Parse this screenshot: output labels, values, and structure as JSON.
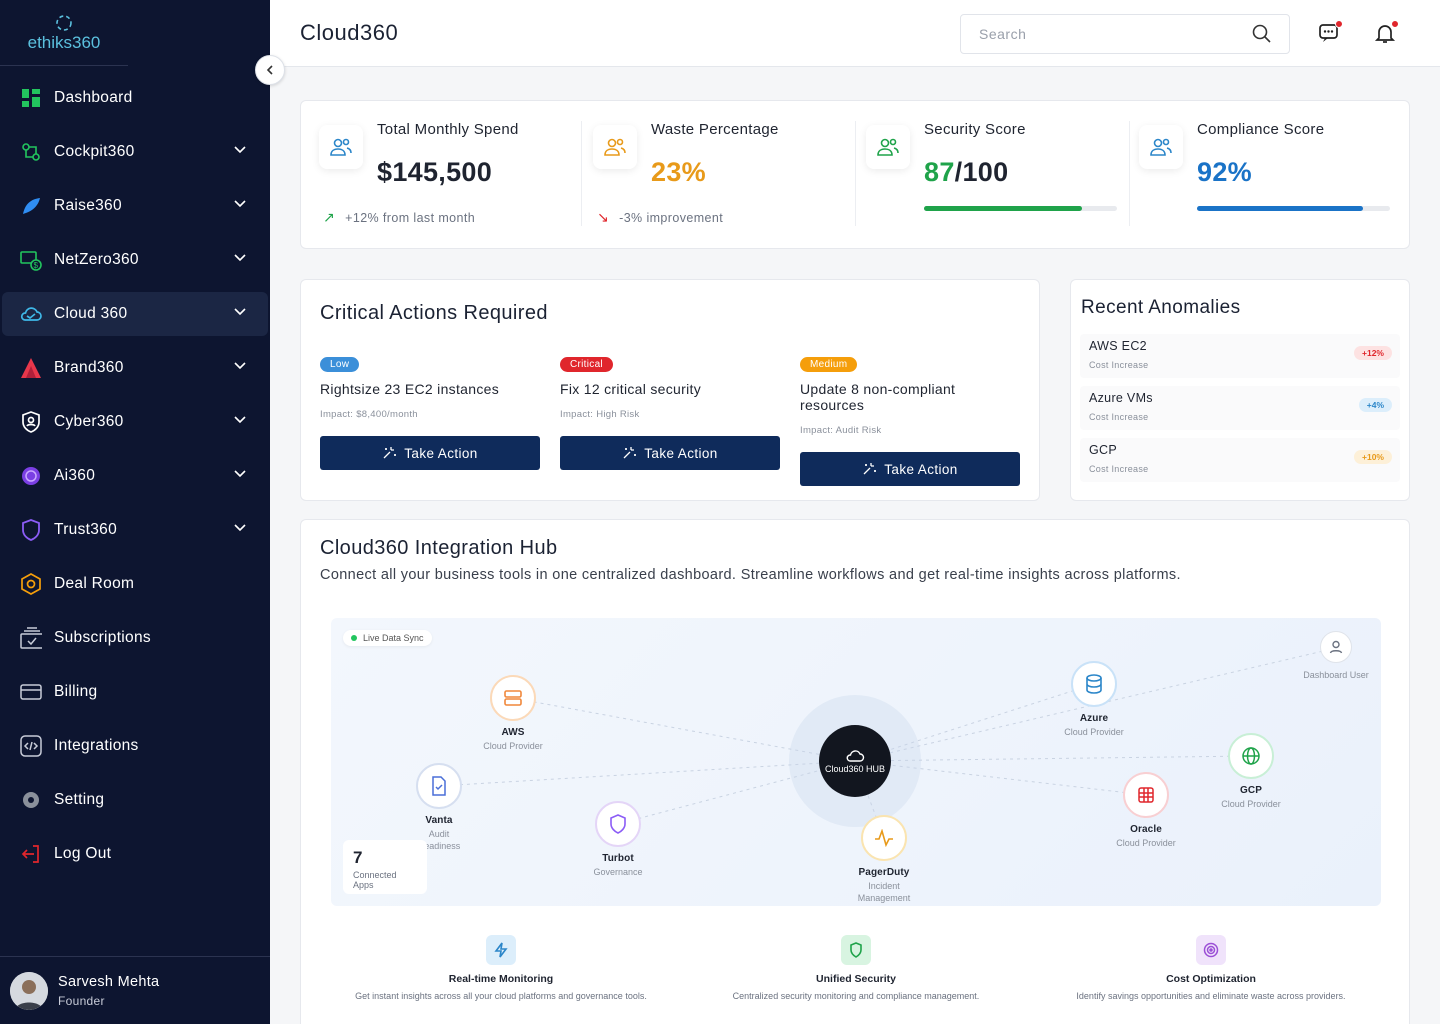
{
  "brand": {
    "name": "ethiks360"
  },
  "sidebar": {
    "items": [
      {
        "label": "Dashboard",
        "icon": "dashboard-grid-icon",
        "chevron": false
      },
      {
        "label": "Cockpit360",
        "icon": "cockpit-icon",
        "chevron": true
      },
      {
        "label": "Raise360",
        "icon": "feather-icon",
        "chevron": true
      },
      {
        "label": "NetZero360",
        "icon": "netzero-money-icon",
        "chevron": true
      },
      {
        "label": "Cloud 360",
        "icon": "cloud-icon",
        "chevron": true,
        "active": true
      },
      {
        "label": "Brand360",
        "icon": "brand-triangle-icon",
        "chevron": true
      },
      {
        "label": "Cyber360",
        "icon": "shield-user-icon",
        "chevron": true
      },
      {
        "label": "Ai360",
        "icon": "ai-orb-icon",
        "chevron": true
      },
      {
        "label": "Trust360",
        "icon": "shield-outline-icon",
        "chevron": true
      },
      {
        "label": "Deal Room",
        "icon": "hexagon-icon",
        "chevron": false
      },
      {
        "label": "Subscriptions",
        "icon": "subscriptions-icon",
        "chevron": false
      },
      {
        "label": "Billing",
        "icon": "credit-card-icon",
        "chevron": false
      },
      {
        "label": "Integrations",
        "icon": "code-icon",
        "chevron": false
      },
      {
        "label": "Setting",
        "icon": "gear-icon",
        "chevron": false
      },
      {
        "label": "Log Out",
        "icon": "logout-icon",
        "chevron": false
      }
    ]
  },
  "user": {
    "name": "Sarvesh Mehta",
    "role": "Founder"
  },
  "header": {
    "title": "Cloud360",
    "search_placeholder": "Search"
  },
  "stats": [
    {
      "label": "Total Monthly Spend",
      "value": "$145,500",
      "sub": "+12% from last month",
      "trend": "up",
      "value_color": "#1f2430"
    },
    {
      "label": "Waste Percentage",
      "value": "23%",
      "sub": "-3% improvement",
      "trend": "down",
      "value_color": "#e89a1a"
    },
    {
      "label": "Security Score",
      "value_main": "87",
      "value_rest": "/100",
      "progress": 0.82,
      "bar_color": "#1fa34a",
      "value_color": "#1fa34a"
    },
    {
      "label": "Compliance Score",
      "value": "92%",
      "progress": 0.86,
      "bar_color": "#1a73c7",
      "value_color": "#1a73c7"
    }
  ],
  "critical": {
    "title": "Critical Actions Required",
    "actions": [
      {
        "badge": "Low",
        "badge_color": "#3b8fd9",
        "title": "Rightsize 23 EC2 instances",
        "impact": "Impact: $8,400/month",
        "button": "Take Action"
      },
      {
        "badge": "Critical",
        "badge_color": "#e0262c",
        "title": "Fix 12 critical security",
        "impact": "Impact: High Risk",
        "button": "Take Action"
      },
      {
        "badge": "Medium",
        "badge_color": "#f59e0b",
        "title": "Update 8 non-compliant resources",
        "impact": "Impact: Audit Risk",
        "button": "Take Action"
      }
    ]
  },
  "anomalies": {
    "title": "Recent Anomalies",
    "items": [
      {
        "name": "AWS EC2",
        "sub": "Cost Increase",
        "badge": "+12%",
        "color": "#e0262c",
        "bg": "#fde2e2"
      },
      {
        "name": "Azure VMs",
        "sub": "Cost Increase",
        "badge": "+4%",
        "color": "#2b86c9",
        "bg": "#dceefb"
      },
      {
        "name": "GCP",
        "sub": "Cost Increase",
        "badge": "+10%",
        "color": "#e89a1a",
        "bg": "#fdf0d8"
      }
    ]
  },
  "hub": {
    "title": "Cloud360 Integration Hub",
    "subtitle": "Connect all your business tools in one centralized dashboard. Streamline workflows and get real-time insights across platforms.",
    "sync_label": "Live Data Sync",
    "center_label": "Cloud360 HUB",
    "connected_count": "7",
    "connected_label": "Connected Apps",
    "nodes": [
      {
        "name": "AWS",
        "type": "Cloud Provider",
        "icon": "server-icon"
      },
      {
        "name": "Vanta",
        "type": "Audit Readiness",
        "icon": "document-check-icon"
      },
      {
        "name": "Turbot",
        "type": "Governance",
        "icon": "shield-icon"
      },
      {
        "name": "PagerDuty",
        "type": "Incident Management",
        "icon": "pulse-icon"
      },
      {
        "name": "Azure",
        "type": "Cloud Provider",
        "icon": "database-icon"
      },
      {
        "name": "Oracle",
        "type": "Cloud Provider",
        "icon": "grid-icon"
      },
      {
        "name": "GCP",
        "type": "Cloud Provider",
        "icon": "globe-icon"
      },
      {
        "name": "",
        "type": "Dashboard User",
        "icon": "user-icon"
      }
    ]
  },
  "features": [
    {
      "title": "Real-time Monitoring",
      "desc": "Get instant insights across all your cloud platforms and governance tools.",
      "icon": "lightning-icon"
    },
    {
      "title": "Unified Security",
      "desc": "Centralized security monitoring and compliance management.",
      "icon": "shield-icon"
    },
    {
      "title": "Cost Optimization",
      "desc": "Identify savings opportunities and eliminate waste across providers.",
      "icon": "target-icon"
    }
  ]
}
